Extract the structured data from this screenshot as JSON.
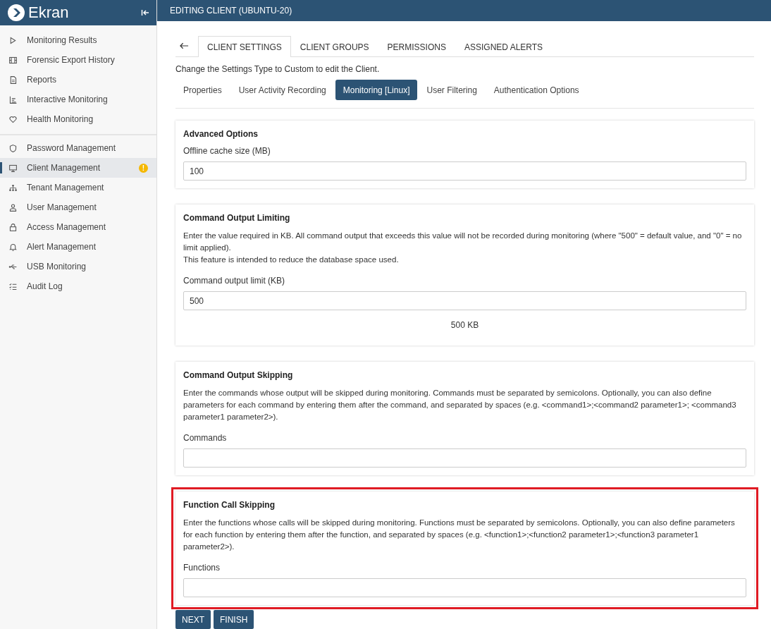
{
  "sidebar": {
    "brand": "Ekran",
    "groups": [
      {
        "items": [
          {
            "label": "Monitoring Results",
            "selected": false
          },
          {
            "label": "Forensic Export History",
            "selected": false
          },
          {
            "label": "Reports",
            "selected": false
          },
          {
            "label": "Interactive Monitoring",
            "selected": false
          },
          {
            "label": "Health Monitoring",
            "selected": false
          }
        ]
      },
      {
        "items": [
          {
            "label": "Password Management",
            "selected": false
          },
          {
            "label": "Client Management",
            "selected": true,
            "badge": "!"
          },
          {
            "label": "Tenant Management",
            "selected": false
          },
          {
            "label": "User Management",
            "selected": false
          },
          {
            "label": "Access Management",
            "selected": false
          },
          {
            "label": "Alert Management",
            "selected": false
          },
          {
            "label": "USB Monitoring",
            "selected": false
          },
          {
            "label": "Audit Log",
            "selected": false
          }
        ]
      }
    ]
  },
  "header": {
    "title": "EDITING CLIENT (UBUNTU-20)"
  },
  "tabs": [
    {
      "label": "CLIENT SETTINGS",
      "selected": true
    },
    {
      "label": "CLIENT GROUPS",
      "selected": false
    },
    {
      "label": "PERMISSIONS",
      "selected": false
    },
    {
      "label": "ASSIGNED ALERTS",
      "selected": false
    }
  ],
  "notice": "Change the Settings Type to Custom to edit the Client.",
  "subtabs": [
    {
      "label": "Properties",
      "selected": false
    },
    {
      "label": "User Activity Recording",
      "selected": false
    },
    {
      "label": "Monitoring [Linux]",
      "selected": true
    },
    {
      "label": "User Filtering",
      "selected": false
    },
    {
      "label": "Authentication Options",
      "selected": false
    }
  ],
  "sections": [
    {
      "title": "Advanced Options",
      "highlighted": false,
      "field_label": "Offline cache size (MB)",
      "value": "100"
    },
    {
      "title": "Command Output Limiting",
      "highlighted": false,
      "paragraphs": [
        "Enter the value required in KB. All command output that exceeds this value will not be recorded during monitoring (where \"500\" = default value, and \"0\" = no limit applied).",
        "This feature is intended to reduce the database space used."
      ],
      "field_label": "Command output limit (KB)",
      "value": "500",
      "readout": "500 KB"
    },
    {
      "title": "Command Output Skipping",
      "highlighted": false,
      "paragraphs": [
        "Enter the commands whose output will be skipped during monitoring. Commands must be separated by semicolons. Optionally, you can also define parameters for each command by entering them after the command, and separated by spaces (e.g. <command1>;<command2 parameter1>; <command3 parameter1 parameter2>)."
      ],
      "field_label": "Commands"
    },
    {
      "title": "Function Call Skipping",
      "highlighted": true,
      "paragraphs": [
        "Enter the functions whose calls will be skipped during monitoring. Functions must be separated by semicolons. Optionally, you can also define parameters for each function by entering them after the function, and separated by spaces (e.g. <function1>;<function2 parameter1>;<function3 parameter1 parameter2>)."
      ],
      "field_label": "Functions"
    }
  ],
  "buttons": [
    "NEXT",
    "FINISH"
  ]
}
